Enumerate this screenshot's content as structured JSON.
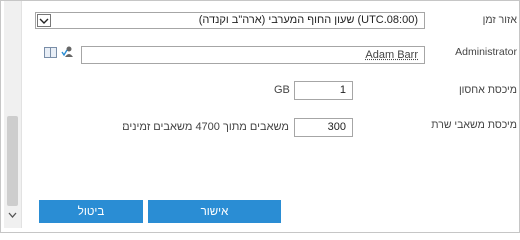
{
  "form": {
    "timezone": {
      "label": "אזור זמן",
      "value": "(UTC.08:00) שעון החוף המערבי (ארה\"ב וקנדה)"
    },
    "administrator": {
      "label": "Administrator",
      "value": "Adam Barr"
    },
    "storage": {
      "label": "מיכסת אחסון",
      "value": "1",
      "unit": "GB"
    },
    "resources": {
      "label": "מיכסת משאבי שרת",
      "value": "300",
      "text": "משאבים  מתוך  4700 משאבים זמינים"
    }
  },
  "buttons": {
    "ok": "אישור",
    "cancel": "ביטול"
  },
  "colors": {
    "button_blue": "#2a8dd4",
    "border": "#a6a6a6"
  },
  "icons": [
    "chevron-down-icon",
    "address-book-icon",
    "check-names-icon",
    "scroll-down-icon"
  ]
}
